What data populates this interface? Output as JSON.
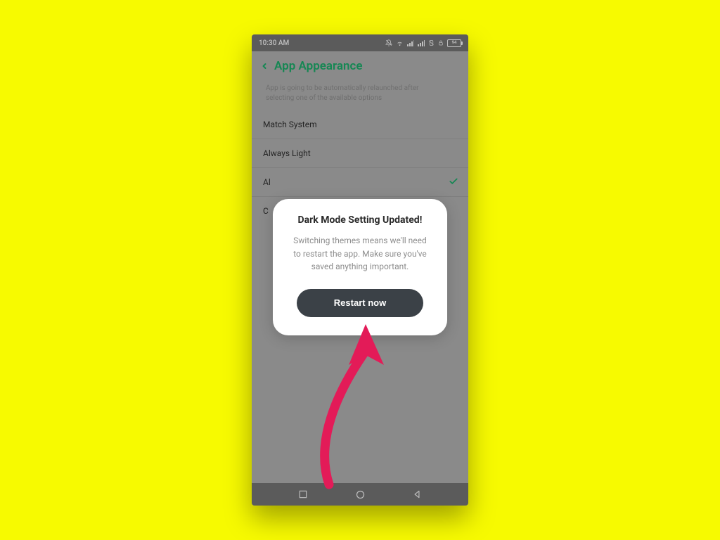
{
  "statusbar": {
    "time": "10:30 AM",
    "battery_text": "94"
  },
  "header": {
    "title": "App Appearance"
  },
  "helper_line1": "App is going to be automatically relaunched after",
  "helper_line2": "selecting one of the available options",
  "options": {
    "match_system": "Match System",
    "always_light": "Always Light",
    "always_dark_initial": "Al",
    "custom_initial": "C"
  },
  "modal": {
    "title": "Dark Mode Setting Updated!",
    "body": "Switching themes means we'll need to restart the app. Make sure you've saved anything important.",
    "button": "Restart now"
  },
  "colors": {
    "accent": "#1aa566",
    "arrow": "#e31b58",
    "page_bg": "#f7fa00",
    "phone_bg": "#a9a9a9",
    "chrome": "#6f6f70",
    "button": "#3b4147"
  }
}
